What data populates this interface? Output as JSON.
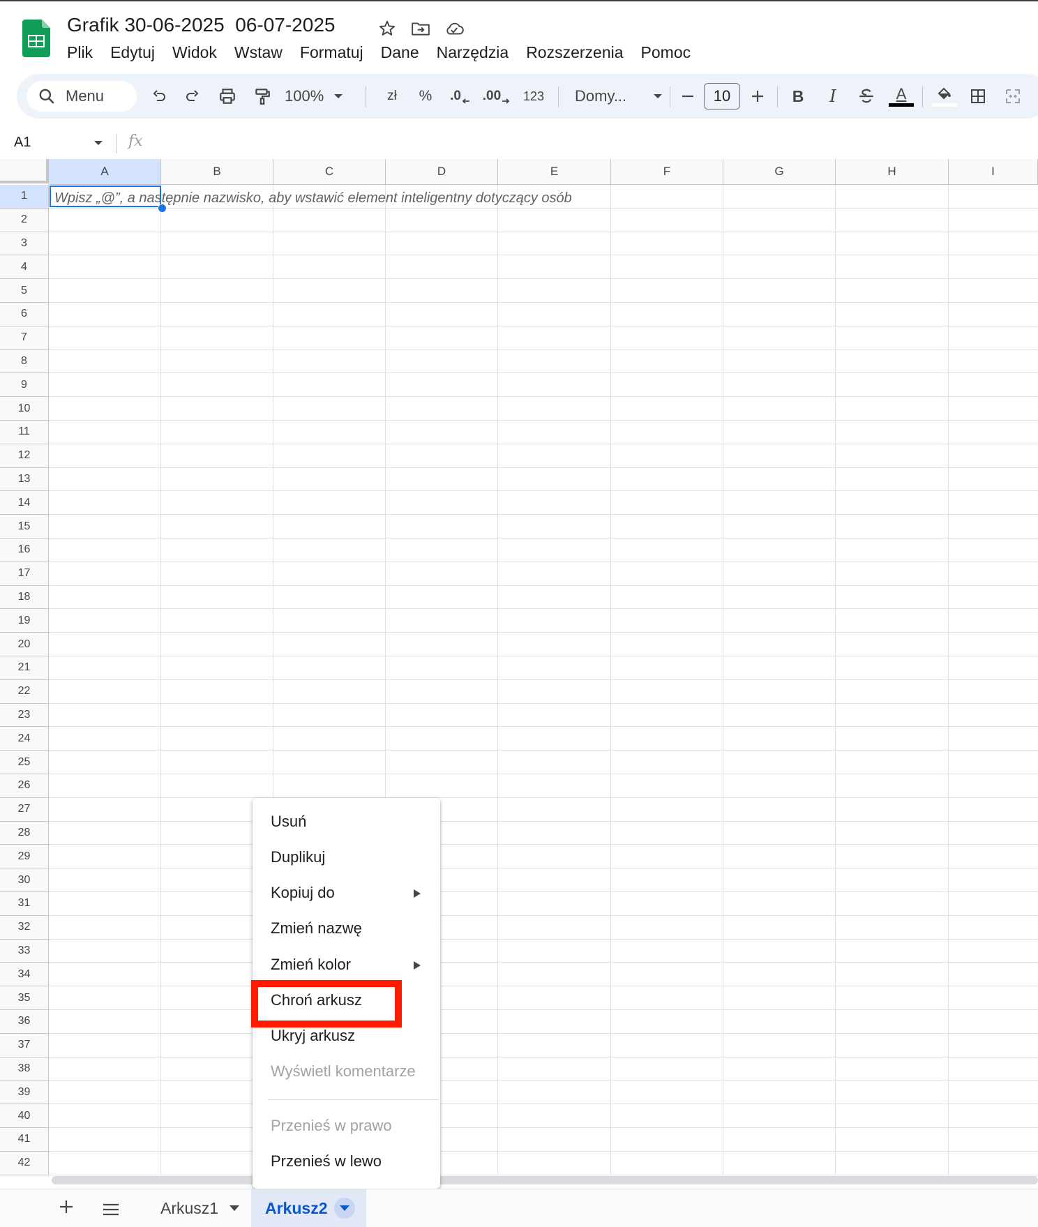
{
  "document": {
    "title": "Grafik 30-06-2025  06-07-2025"
  },
  "menubar": [
    "Plik",
    "Edytuj",
    "Widok",
    "Wstaw",
    "Formatuj",
    "Dane",
    "Narzędzia",
    "Rozszerzenia",
    "Pomoc"
  ],
  "toolbar": {
    "search_label": "Menu",
    "zoom": "100%",
    "currency": "zł",
    "percent": "%",
    "decrease_decimal": ".0",
    "increase_decimal": ".00",
    "number_format": "123",
    "font": "Domy...",
    "font_size": "10",
    "bold": "B",
    "italic": "I",
    "text_color_letter": "A"
  },
  "formula_bar": {
    "cell_ref": "A1",
    "fx": "fx",
    "value": ""
  },
  "grid": {
    "columns": [
      "A",
      "B",
      "C",
      "D",
      "E",
      "F",
      "G",
      "H",
      "I"
    ],
    "rows": [
      "1",
      "2",
      "3",
      "4",
      "5",
      "6",
      "7",
      "8",
      "9",
      "10",
      "11",
      "12",
      "13",
      "14",
      "15",
      "16",
      "17",
      "18",
      "19",
      "20",
      "21",
      "22",
      "23",
      "24",
      "25",
      "26",
      "27",
      "28",
      "29",
      "30",
      "31",
      "32",
      "33",
      "34",
      "35",
      "36",
      "37",
      "38",
      "39",
      "40",
      "41",
      "42"
    ],
    "a1_hint": "Wpisz „@”, a następnie nazwisko, aby wstawić element inteligentny dotyczący osób"
  },
  "context_menu": {
    "items": [
      {
        "label": "Usuń",
        "disabled": false,
        "submenu": false
      },
      {
        "label": "Duplikuj",
        "disabled": false,
        "submenu": false
      },
      {
        "label": "Kopiuj do",
        "disabled": false,
        "submenu": true
      },
      {
        "label": "Zmień nazwę",
        "disabled": false,
        "submenu": false
      },
      {
        "label": "Zmień kolor",
        "disabled": false,
        "submenu": true
      },
      {
        "label": "Chroń arkusz",
        "disabled": false,
        "submenu": false,
        "highlighted": true
      },
      {
        "label": "Ukryj arkusz",
        "disabled": false,
        "submenu": false
      },
      {
        "label": "Wyświetl komentarze",
        "disabled": true,
        "submenu": false
      },
      {
        "label": "Przenieś w prawo",
        "disabled": true,
        "submenu": false
      },
      {
        "label": "Przenieś w lewo",
        "disabled": false,
        "submenu": false
      }
    ]
  },
  "sheets": {
    "tabs": [
      {
        "label": "Arkusz1",
        "active": false
      },
      {
        "label": "Arkusz2",
        "active": true
      }
    ]
  },
  "colors": {
    "accent": "#1a73e8",
    "active_tab_text": "#0b57d0",
    "highlight_box": "#ff1a00",
    "sheets_green": "#0f9d58"
  }
}
